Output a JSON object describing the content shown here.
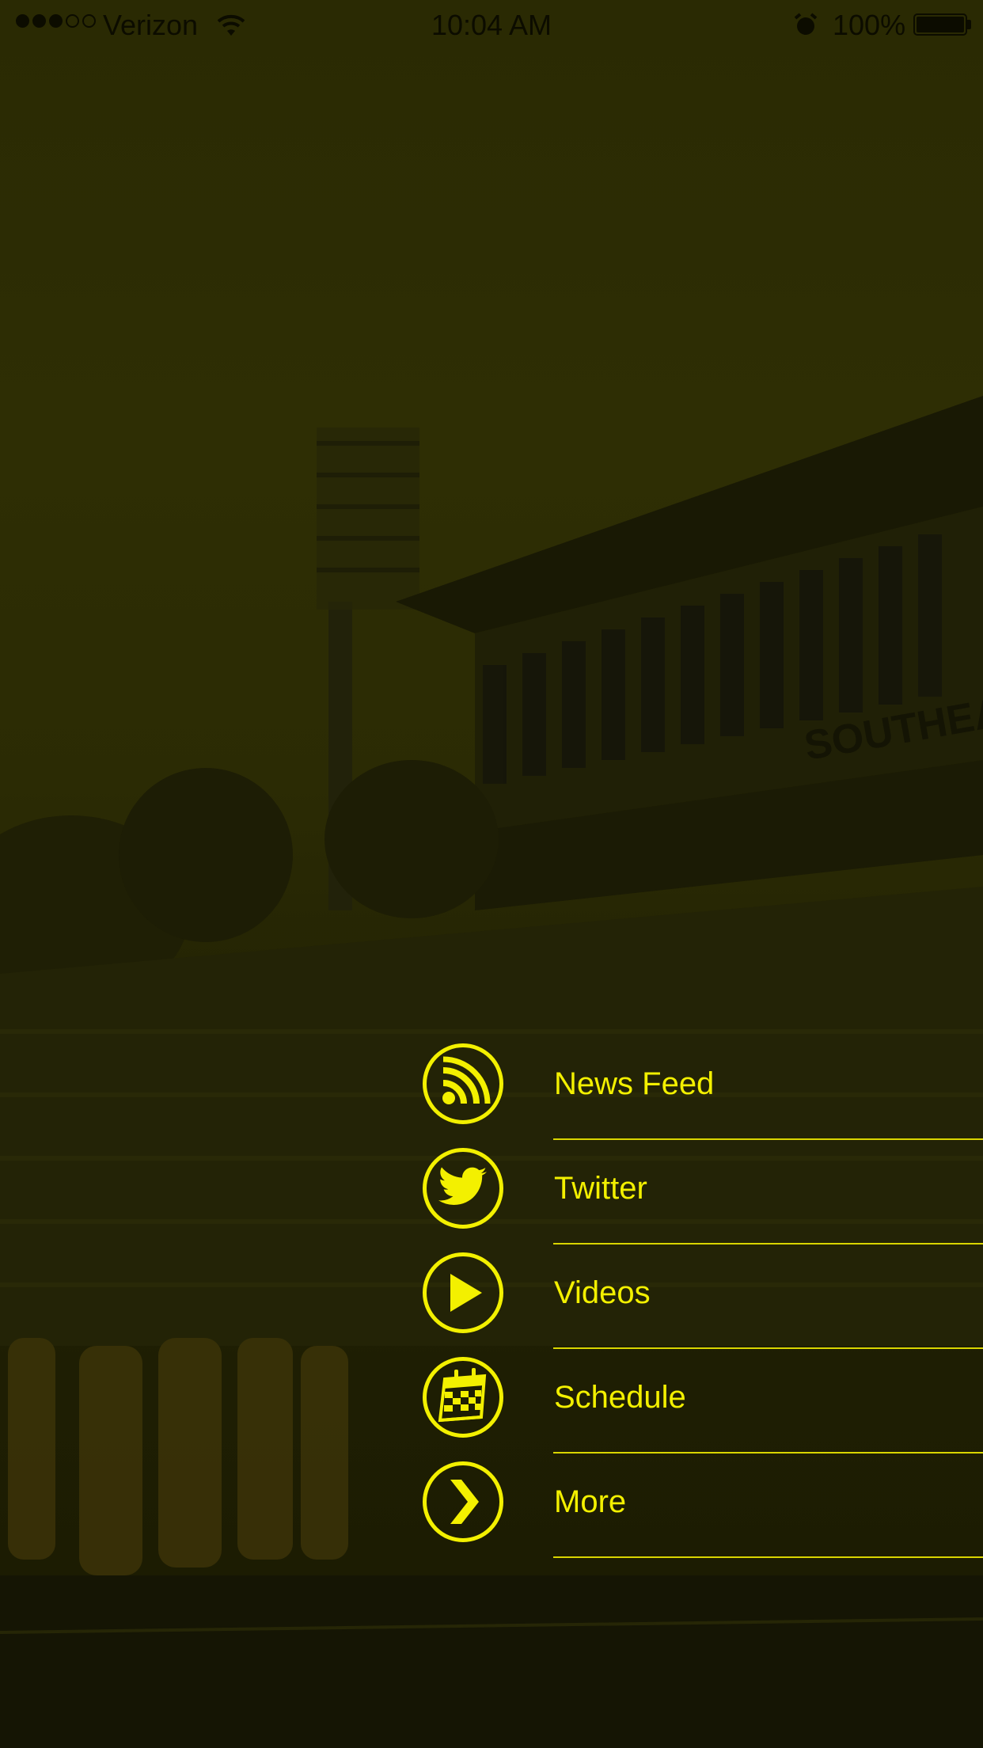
{
  "status_bar": {
    "carrier": "Verizon",
    "time": "10:04 AM",
    "battery": "100%",
    "signal_bars_filled": 3,
    "signal_bars_total": 5
  },
  "background": {
    "stadium_sign": "SOUTHEAST"
  },
  "menu": {
    "items": [
      {
        "label": "News Feed",
        "icon": "rss-icon"
      },
      {
        "label": "Twitter",
        "icon": "twitter-bird-icon"
      },
      {
        "label": "Videos",
        "icon": "play-icon"
      },
      {
        "label": "Schedule",
        "icon": "calendar-icon"
      },
      {
        "label": "More",
        "icon": "chevron-right-icon"
      }
    ]
  },
  "colors": {
    "accent": "#f3f000",
    "overlay": "#2a2a03"
  }
}
